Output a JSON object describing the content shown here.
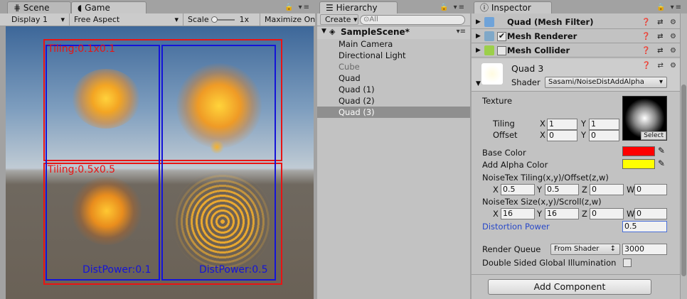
{
  "game_panel": {
    "tabs": [
      "Scene",
      "Game"
    ],
    "display": "Display 1",
    "aspect": "Free Aspect",
    "scale_label": "Scale",
    "scale_value": "1x",
    "maximize": "Maximize On",
    "labels": {
      "tiling_top": "Tiling:0.1x0.1",
      "tiling_bottom": "Tiling:0.5x0.5",
      "dist_left": "DistPower:0.1",
      "dist_right": "DistPower:0.5"
    }
  },
  "hierarchy": {
    "tab": "Hierarchy",
    "create": "Create ▾",
    "search_placeholder": "⊙All",
    "scene": "SampleScene*",
    "items": [
      "Main Camera",
      "Directional Light",
      "Cube",
      "Quad",
      "Quad (1)",
      "Quad (2)",
      "Quad (3)"
    ]
  },
  "inspector": {
    "tab": "Inspector",
    "components": [
      "Quad (Mesh Filter)",
      "Mesh Renderer",
      "Mesh Collider"
    ],
    "material_name": "Quad 3",
    "shader_label": "Shader",
    "shader_value": "Sasami/NoiseDistAddAlpha",
    "texture_label": "Texture",
    "tiling_label": "Tiling",
    "offset_label": "Offset",
    "tiling_x": "1",
    "tiling_y": "1",
    "offset_x": "0",
    "offset_y": "0",
    "axis_x": "X",
    "axis_y": "Y",
    "axis_z": "Z",
    "axis_w": "W",
    "select_btn": "Select",
    "base_color_label": "Base Color",
    "add_alpha_color_label": "Add Alpha Color",
    "noise_tiling_label": "NoiseTex Tiling(x,y)/Offset(z,w)",
    "noise_tiling": [
      "0.5",
      "0.5",
      "0",
      "0"
    ],
    "noise_size_label": "NoiseTex Size(x,y)/Scroll(z,w)",
    "noise_size": [
      "16",
      "16",
      "0",
      "0"
    ],
    "distortion_label": "Distortion Power",
    "distortion_value": "0.5",
    "render_queue_label": "Render Queue",
    "render_queue_mode": "From Shader",
    "render_queue_value": "3000",
    "double_sided_label": "Double Sided Global Illumination",
    "add_component": "Add Component"
  },
  "colors": {
    "base_color": "#ff0000",
    "add_alpha_color": "#ffff00",
    "selected_row": "#8f8f8f",
    "label_red": "#e81414",
    "label_blue": "#1414d8",
    "distortion_label": "#2848c8"
  }
}
